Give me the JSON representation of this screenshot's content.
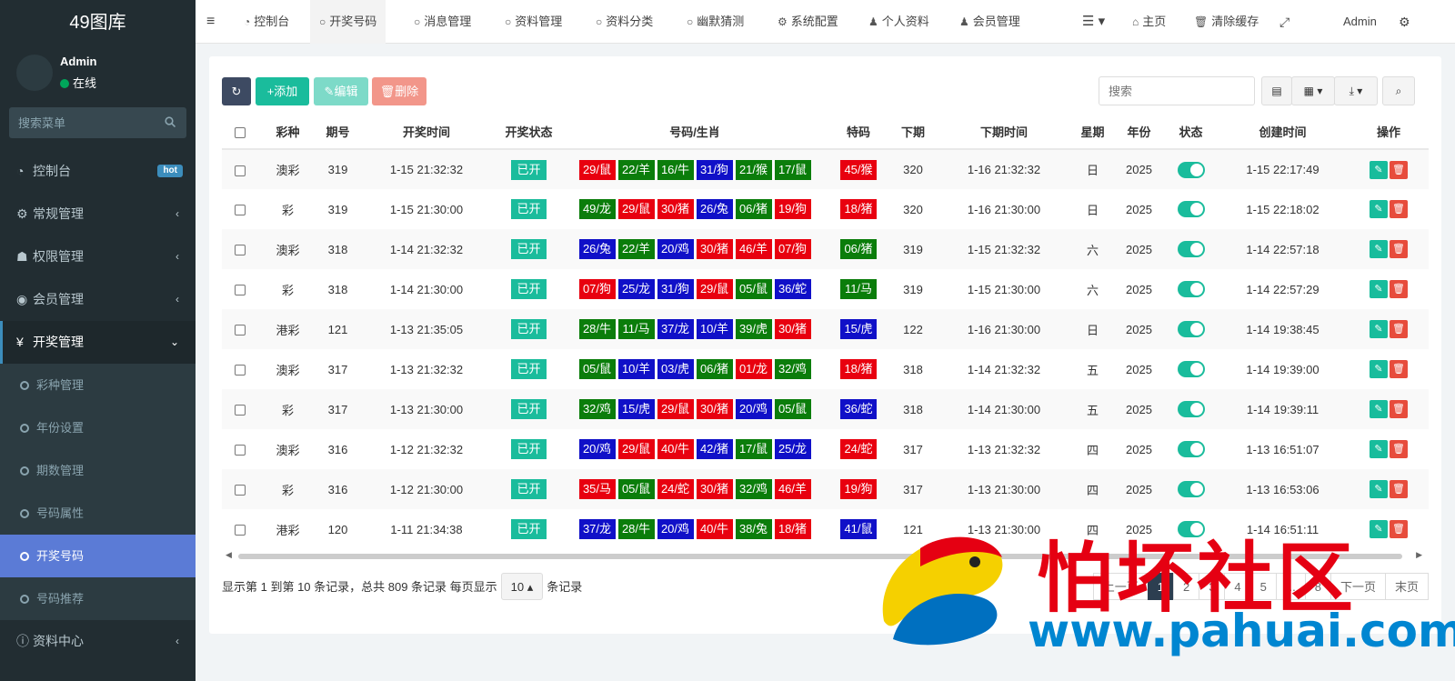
{
  "app": {
    "title": "49图库"
  },
  "user": {
    "name": "Admin",
    "status": "在线"
  },
  "sidebar": {
    "search_placeholder": "搜索菜单",
    "items": [
      {
        "label": "控制台",
        "badge": "hot"
      },
      {
        "label": "常规管理"
      },
      {
        "label": "权限管理"
      },
      {
        "label": "会员管理"
      },
      {
        "label": "开奖管理"
      }
    ],
    "sub_items": [
      {
        "label": "彩种管理"
      },
      {
        "label": "年份设置"
      },
      {
        "label": "期数管理"
      },
      {
        "label": "号码属性"
      },
      {
        "label": "开奖号码"
      },
      {
        "label": "号码推荐"
      }
    ],
    "bottom_item": {
      "label": "资料中心"
    }
  },
  "topnav": {
    "tabs": [
      "控制台",
      "开奖号码",
      "消息管理",
      "资料管理",
      "资料分类",
      "幽默猜测",
      "系统配置",
      "个人资料",
      "会员管理"
    ],
    "home": "主页",
    "clear_cache": "清除缓存",
    "admin": "Admin"
  },
  "toolbar": {
    "add": "添加",
    "edit": "编辑",
    "delete": "删除",
    "search_placeholder": "搜索"
  },
  "table": {
    "headers": [
      "彩种",
      "期号",
      "开奖时间",
      "开奖状态",
      "号码/生肖",
      "特码",
      "下期",
      "下期时间",
      "星期",
      "年份",
      "状态",
      "创建时间",
      "操作"
    ],
    "rows": [
      {
        "type": "澳彩",
        "issue": "319",
        "time": "1-15 21:32:32",
        "status": "已开",
        "nums": [
          [
            "29/鼠",
            "r"
          ],
          [
            "22/羊",
            "g"
          ],
          [
            "16/牛",
            "g"
          ],
          [
            "31/狗",
            "b"
          ],
          [
            "21/猴",
            "g"
          ],
          [
            "17/鼠",
            "g"
          ]
        ],
        "special": [
          "45/猴",
          "r"
        ],
        "next": "320",
        "next_time": "1-16 21:32:32",
        "week": "日",
        "year": "2025",
        "created": "1-15 22:17:49"
      },
      {
        "type": "彩",
        "issue": "319",
        "time": "1-15 21:30:00",
        "status": "已开",
        "nums": [
          [
            "49/龙",
            "g"
          ],
          [
            "29/鼠",
            "r"
          ],
          [
            "30/猪",
            "r"
          ],
          [
            "26/兔",
            "b"
          ],
          [
            "06/猪",
            "g"
          ],
          [
            "19/狗",
            "r"
          ]
        ],
        "special": [
          "18/猪",
          "r"
        ],
        "next": "320",
        "next_time": "1-16 21:30:00",
        "week": "日",
        "year": "2025",
        "created": "1-15 22:18:02"
      },
      {
        "type": "澳彩",
        "issue": "318",
        "time": "1-14 21:32:32",
        "status": "已开",
        "nums": [
          [
            "26/兔",
            "b"
          ],
          [
            "22/羊",
            "g"
          ],
          [
            "20/鸡",
            "b"
          ],
          [
            "30/猪",
            "r"
          ],
          [
            "46/羊",
            "r"
          ],
          [
            "07/狗",
            "r"
          ]
        ],
        "special": [
          "06/猪",
          "g"
        ],
        "next": "319",
        "next_time": "1-15 21:32:32",
        "week": "六",
        "year": "2025",
        "created": "1-14 22:57:18"
      },
      {
        "type": "彩",
        "issue": "318",
        "time": "1-14 21:30:00",
        "status": "已开",
        "nums": [
          [
            "07/狗",
            "r"
          ],
          [
            "25/龙",
            "b"
          ],
          [
            "31/狗",
            "b"
          ],
          [
            "29/鼠",
            "r"
          ],
          [
            "05/鼠",
            "g"
          ],
          [
            "36/蛇",
            "b"
          ]
        ],
        "special": [
          "11/马",
          "g"
        ],
        "next": "319",
        "next_time": "1-15 21:30:00",
        "week": "六",
        "year": "2025",
        "created": "1-14 22:57:29"
      },
      {
        "type": "港彩",
        "issue": "121",
        "time": "1-13 21:35:05",
        "status": "已开",
        "nums": [
          [
            "28/牛",
            "g"
          ],
          [
            "11/马",
            "g"
          ],
          [
            "37/龙",
            "b"
          ],
          [
            "10/羊",
            "b"
          ],
          [
            "39/虎",
            "g"
          ],
          [
            "30/猪",
            "r"
          ]
        ],
        "special": [
          "15/虎",
          "b"
        ],
        "next": "122",
        "next_time": "1-16 21:30:00",
        "week": "日",
        "year": "2025",
        "created": "1-14 19:38:45"
      },
      {
        "type": "澳彩",
        "issue": "317",
        "time": "1-13 21:32:32",
        "status": "已开",
        "nums": [
          [
            "05/鼠",
            "g"
          ],
          [
            "10/羊",
            "b"
          ],
          [
            "03/虎",
            "b"
          ],
          [
            "06/猪",
            "g"
          ],
          [
            "01/龙",
            "r"
          ],
          [
            "32/鸡",
            "g"
          ]
        ],
        "special": [
          "18/猪",
          "r"
        ],
        "next": "318",
        "next_time": "1-14 21:32:32",
        "week": "五",
        "year": "2025",
        "created": "1-14 19:39:00"
      },
      {
        "type": "彩",
        "issue": "317",
        "time": "1-13 21:30:00",
        "status": "已开",
        "nums": [
          [
            "32/鸡",
            "g"
          ],
          [
            "15/虎",
            "b"
          ],
          [
            "29/鼠",
            "r"
          ],
          [
            "30/猪",
            "r"
          ],
          [
            "20/鸡",
            "b"
          ],
          [
            "05/鼠",
            "g"
          ]
        ],
        "special": [
          "36/蛇",
          "b"
        ],
        "next": "318",
        "next_time": "1-14 21:30:00",
        "week": "五",
        "year": "2025",
        "created": "1-14 19:39:11"
      },
      {
        "type": "澳彩",
        "issue": "316",
        "time": "1-12 21:32:32",
        "status": "已开",
        "nums": [
          [
            "20/鸡",
            "b"
          ],
          [
            "29/鼠",
            "r"
          ],
          [
            "40/牛",
            "r"
          ],
          [
            "42/猪",
            "b"
          ],
          [
            "17/鼠",
            "g"
          ],
          [
            "25/龙",
            "b"
          ]
        ],
        "special": [
          "24/蛇",
          "r"
        ],
        "next": "317",
        "next_time": "1-13 21:32:32",
        "week": "四",
        "year": "2025",
        "created": "1-13 16:51:07"
      },
      {
        "type": "彩",
        "issue": "316",
        "time": "1-12 21:30:00",
        "status": "已开",
        "nums": [
          [
            "35/马",
            "r"
          ],
          [
            "05/鼠",
            "g"
          ],
          [
            "24/蛇",
            "r"
          ],
          [
            "30/猪",
            "r"
          ],
          [
            "32/鸡",
            "g"
          ],
          [
            "46/羊",
            "r"
          ]
        ],
        "special": [
          "19/狗",
          "r"
        ],
        "next": "317",
        "next_time": "1-13 21:30:00",
        "week": "四",
        "year": "2025",
        "created": "1-13 16:53:06"
      },
      {
        "type": "港彩",
        "issue": "120",
        "time": "1-11 21:34:38",
        "status": "已开",
        "nums": [
          [
            "37/龙",
            "b"
          ],
          [
            "28/牛",
            "g"
          ],
          [
            "20/鸡",
            "b"
          ],
          [
            "40/牛",
            "r"
          ],
          [
            "38/兔",
            "g"
          ],
          [
            "18/猪",
            "r"
          ]
        ],
        "special": [
          "41/鼠",
          "b"
        ],
        "next": "121",
        "next_time": "1-13 21:30:00",
        "week": "四",
        "year": "2025",
        "created": "1-14 16:51:11"
      }
    ]
  },
  "footer": {
    "info_before": "显示第 1 到第 10 条记录，总共 809 条记录 每页显示",
    "page_size": "10",
    "info_after": "条记录",
    "prev": "上一页",
    "pages": [
      "1",
      "2",
      "3",
      "4",
      "5",
      "...",
      "8"
    ],
    "next": "下一页",
    "last": "末页"
  },
  "colors": {
    "r": "#e8000f",
    "g": "#0b7d0b",
    "b": "#1010c8",
    "accent": "#1abc9c",
    "sidebar": "#222d32"
  },
  "watermark": {
    "text": "怕坏社区",
    "url": "www.pahuai.com"
  }
}
